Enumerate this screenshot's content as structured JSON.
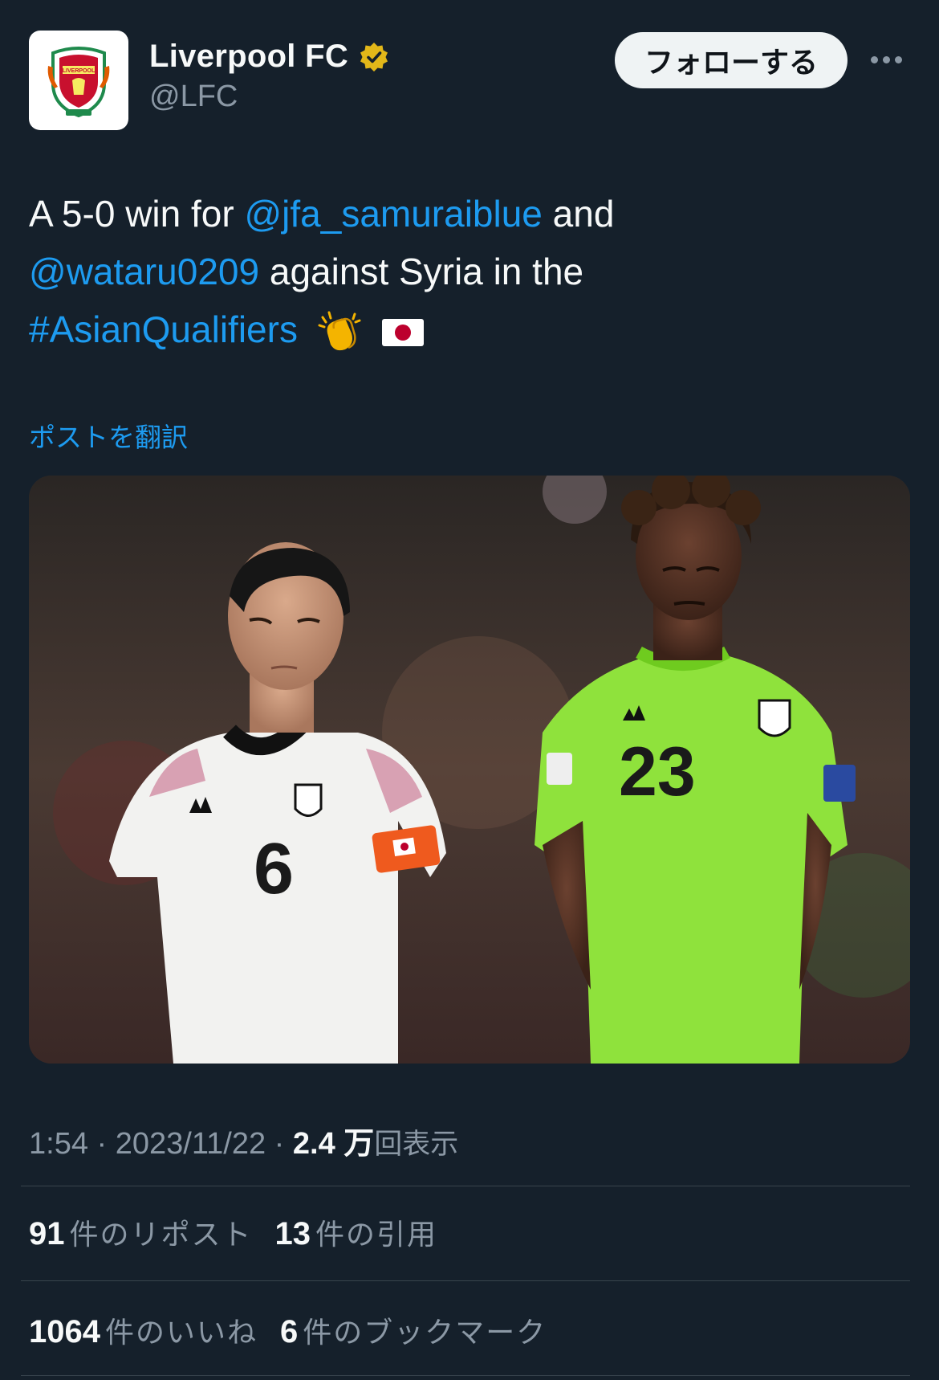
{
  "author": {
    "display_name": "Liverpool FC",
    "handle": "@LFC",
    "verified_icon": "verified-badge-icon",
    "avatar_icon": "liverpool-crest-icon",
    "avatar_crest_text": "LIVERPOOL"
  },
  "actions": {
    "follow_label": "フォローする",
    "more_icon": "more-options-icon"
  },
  "tweet": {
    "text_1": "A 5-0 win for ",
    "mention_1": "@jfa_samuraiblue",
    "text_2": " and",
    "mention_2": "@wataru0209",
    "text_3": " against Syria in the",
    "hashtag": "#AsianQualifiers",
    "emoji_1": "clapping-hands-icon",
    "emoji_2": "japan-flag-icon"
  },
  "translate_label": "ポストを翻訳",
  "media": {
    "player_left_number": "6",
    "player_right_number": "23"
  },
  "meta": {
    "time": "1:54",
    "separator": " · ",
    "date": "2023/11/22",
    "views_count": "2.4 万",
    "views_label": "回表示"
  },
  "stats": {
    "reposts_count": "91",
    "reposts_label": "件のリポスト",
    "quotes_count": "13",
    "quotes_label": "件の引用",
    "likes_count": "1064",
    "likes_label": "件のいいね",
    "bookmarks_count": "6",
    "bookmarks_label": "件のブックマーク"
  },
  "colors": {
    "background": "#15202b",
    "link": "#1d9bf0",
    "muted": "#8b98a5",
    "verified": "#e2b719"
  }
}
